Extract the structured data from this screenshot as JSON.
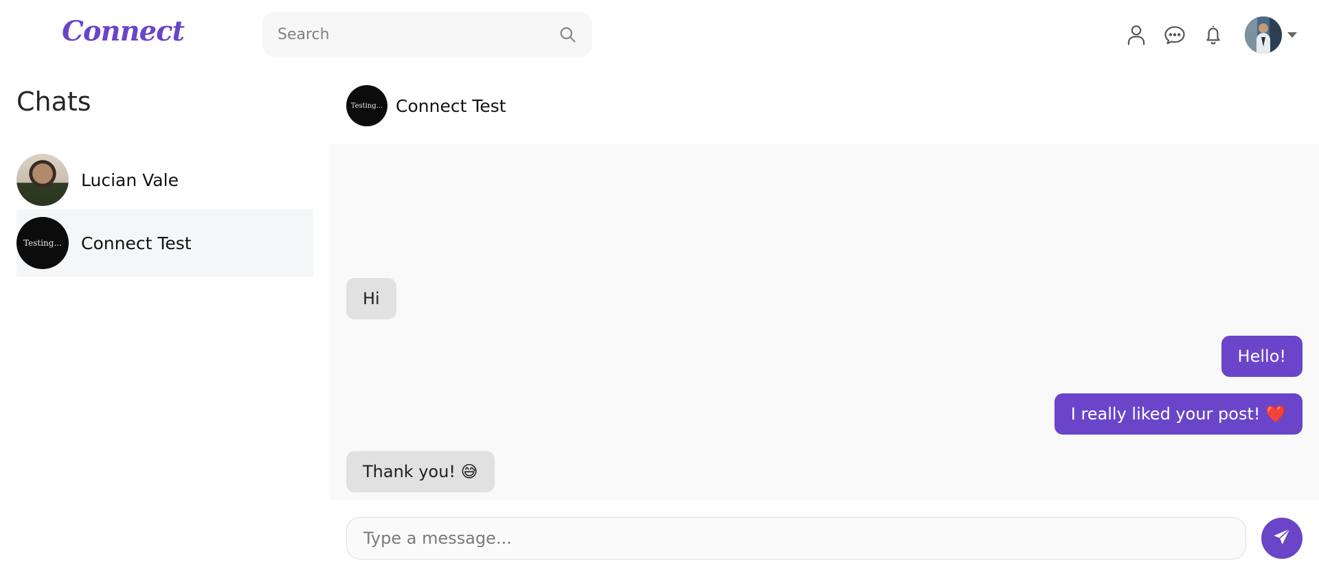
{
  "header": {
    "logo": "Connect",
    "search_placeholder": "Search",
    "icons": [
      "search-icon",
      "profile-icon",
      "chat-icon",
      "bell-icon",
      "caret-down-icon"
    ]
  },
  "sidebar": {
    "title": "Chats",
    "items": [
      {
        "name": "Lucian Vale",
        "active": false
      },
      {
        "name": "Connect Test",
        "active": true,
        "avatar_text": "Testing..."
      }
    ]
  },
  "chat": {
    "title": "Connect Test",
    "avatar_text": "Testing...",
    "messages": [
      {
        "direction": "in",
        "text": "Hi"
      },
      {
        "direction": "out",
        "text": "Hello!"
      },
      {
        "direction": "out",
        "text": "I really liked your post! ❤️"
      },
      {
        "direction": "in",
        "text": "Thank you! 😅"
      }
    ],
    "composer_placeholder": "Type a message...",
    "send_icon": "send-icon"
  },
  "colors": {
    "accent": "#6a45c9",
    "incoming_bubble": "#e1e1e1",
    "messages_bg": "#f9f9f9"
  }
}
